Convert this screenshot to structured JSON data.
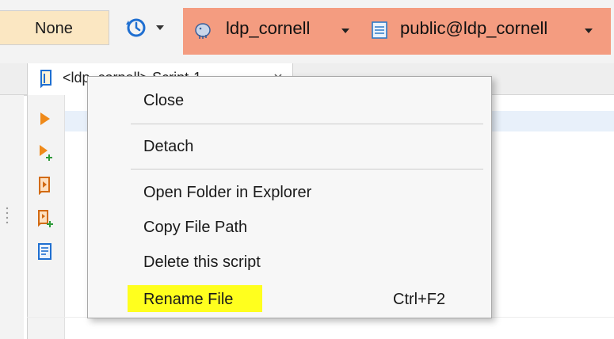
{
  "toolbar": {
    "transaction_mode": "None",
    "history_icon": "history-clock-icon",
    "datasource": {
      "label": "ldp_cornell",
      "icon": "postgres-elephant-icon"
    },
    "schema": {
      "label": "public@ldp_cornell",
      "icon": "schema-table-icon"
    },
    "highlight_color": "#f49c80"
  },
  "editor_tab": {
    "label": "<ldp_cornell> Script-1",
    "icon": "sql-script-icon",
    "close_icon": "tab-close-icon"
  },
  "gutter": {
    "buttons": [
      "execute-statement-icon",
      "execute-in-new-tab-icon",
      "execute-script-icon",
      "execute-script-new-tab-icon",
      "explain-plan-icon"
    ]
  },
  "context_menu": {
    "items": [
      {
        "label": "Close",
        "shortcut": ""
      },
      {
        "label": "Detach",
        "shortcut": ""
      },
      {
        "label": "Open Folder in Explorer",
        "shortcut": ""
      },
      {
        "label": "Copy File Path",
        "shortcut": ""
      },
      {
        "label": "Delete this script",
        "shortcut": ""
      },
      {
        "label": "Rename File",
        "shortcut": "Ctrl+F2"
      }
    ],
    "highlight_color": "#ffff1e"
  }
}
